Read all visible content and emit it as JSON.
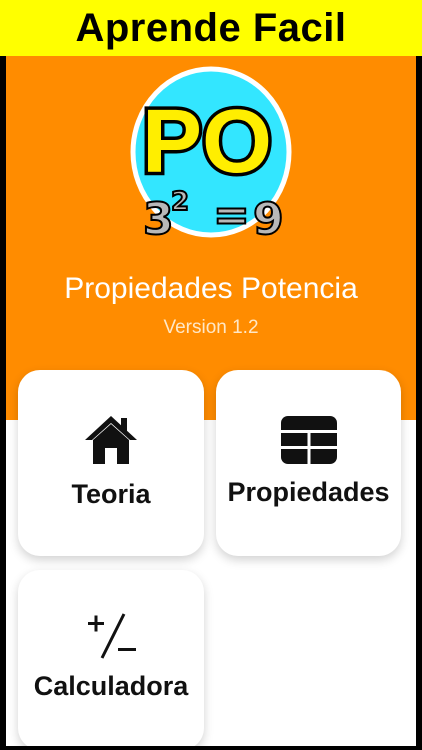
{
  "banner": {
    "title": "Aprende Facil"
  },
  "app": {
    "logo_text": "PO",
    "logo_formula": {
      "base": "3",
      "exponent": "2",
      "equals": "=",
      "result": "9"
    },
    "name": "Propiedades Potencia",
    "version": "Version 1.2"
  },
  "menu": {
    "items": [
      {
        "label": "Teoria",
        "icon": "home-icon"
      },
      {
        "label": "Propiedades",
        "icon": "grid-icon"
      },
      {
        "label": "Calculadora",
        "icon": "plus-minus-icon"
      }
    ]
  },
  "colors": {
    "banner": "#ffff00",
    "header": "#ff8c00",
    "logo_background": "#33e6ff",
    "logo_text_fill": "#ffee00"
  }
}
